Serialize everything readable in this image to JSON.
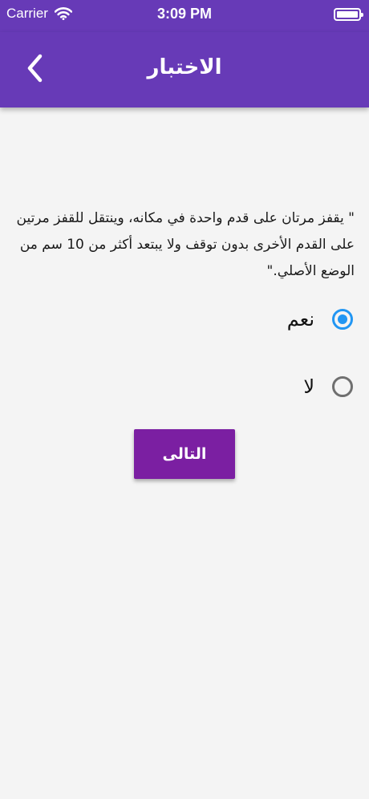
{
  "status_bar": {
    "carrier": "Carrier",
    "time": "3:09 PM",
    "wifi_icon": "wifi-icon",
    "battery_icon": "battery-icon"
  },
  "app_bar": {
    "title": "الاختبار",
    "back_icon": "chevron-left-icon",
    "background_color": "#673ab7"
  },
  "question": {
    "text": "\" يقفز مرتان على قدم واحدة في مكانه، وينتقل للقفز مرتين على القدم الأخرى بدون توقف ولا يبتعد أكثر من 10 سم من الوضع الأصلي.\""
  },
  "options": [
    {
      "label": "نعم",
      "selected": true
    },
    {
      "label": "لا",
      "selected": false
    }
  ],
  "next_button": {
    "label": "التالى",
    "color": "#7b1fa2"
  },
  "colors": {
    "radio_selected": "#2196f3",
    "radio_unselected": "#6f6f6f",
    "page_background": "#f4f4f4"
  }
}
